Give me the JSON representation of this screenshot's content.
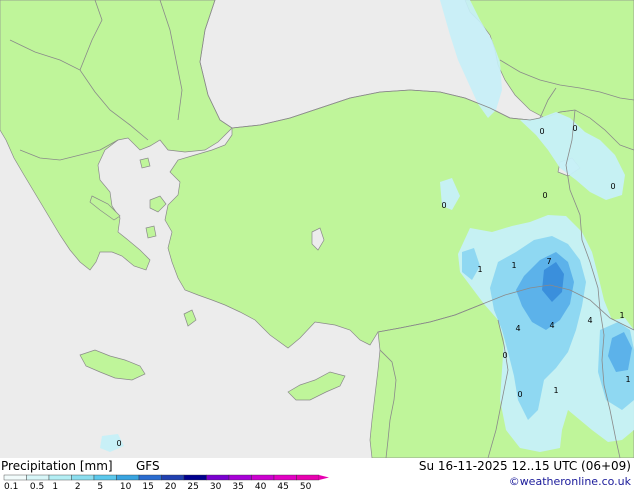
{
  "header": {
    "title": "Precipitation [mm]",
    "model": "GFS",
    "datetime": "Su 16-11-2025 12..15 UTC (06+09)",
    "credit": "©weatheronline.co.uk"
  },
  "scale": {
    "labels": [
      "0.1",
      "0.5",
      "1",
      "2",
      "5",
      "10",
      "15",
      "20",
      "25",
      "30",
      "35",
      "40",
      "45",
      "50"
    ],
    "colors": [
      "#f2fcfc",
      "#d8f6f8",
      "#b4eef4",
      "#8cdeef",
      "#5bc8ec",
      "#38a4e0",
      "#2a6cd0",
      "#2040b0",
      "#00008e",
      "#7a00d0",
      "#a800d8",
      "#cc00d0",
      "#e200c4",
      "#e800b0"
    ]
  },
  "map": {
    "colors": {
      "land": "#bff59a",
      "sea": "#ececec",
      "border": "#8a8a8a",
      "precip_light": "#c6f0f8",
      "precip_mid": "#8fd8f2",
      "precip_heavy": "#5cb2ea"
    },
    "station_labels": [
      "1",
      "1",
      "7",
      "4",
      "4",
      "4",
      "1",
      "1",
      "1",
      "0",
      "0",
      "0",
      "0",
      "0",
      "0",
      "0",
      "0"
    ]
  }
}
